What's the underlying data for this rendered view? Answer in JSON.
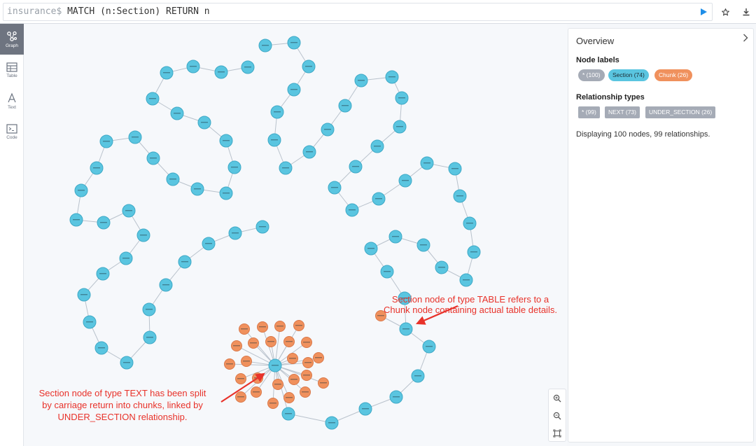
{
  "query": {
    "prompt": "insurance$",
    "text": "MATCH (n:Section) RETURN n"
  },
  "rail": [
    {
      "label": "Graph",
      "icon": "graph-icon"
    },
    {
      "label": "Table",
      "icon": "table-icon"
    },
    {
      "label": "Text",
      "icon": "text-icon"
    },
    {
      "label": "Code",
      "icon": "code-icon"
    }
  ],
  "overview": {
    "title": "Overview",
    "node_labels_heading": "Node labels",
    "node_labels": [
      "* (100)",
      "Section (74)",
      "Chunk (26)"
    ],
    "rel_types_heading": "Relationship types",
    "rel_types": [
      "* (99)",
      "NEXT (73)",
      "UNDER_SECTION (26)"
    ],
    "status": "Displaying 100 nodes, 99 relationships."
  },
  "annotations": {
    "table": [
      "Section node of type TABLE refers to a",
      "Chunk node containing actual table details."
    ],
    "text": [
      "Section node of type TEXT has been split",
      "by carriage return into chunks, linked by",
      "UNDER_SECTION relationship."
    ]
  },
  "colors": {
    "section": "#5ac5e0",
    "chunk": "#f0915d",
    "accent": "#1e8ee8",
    "annotation": "#e8322a",
    "all": "#a5abb6"
  }
}
